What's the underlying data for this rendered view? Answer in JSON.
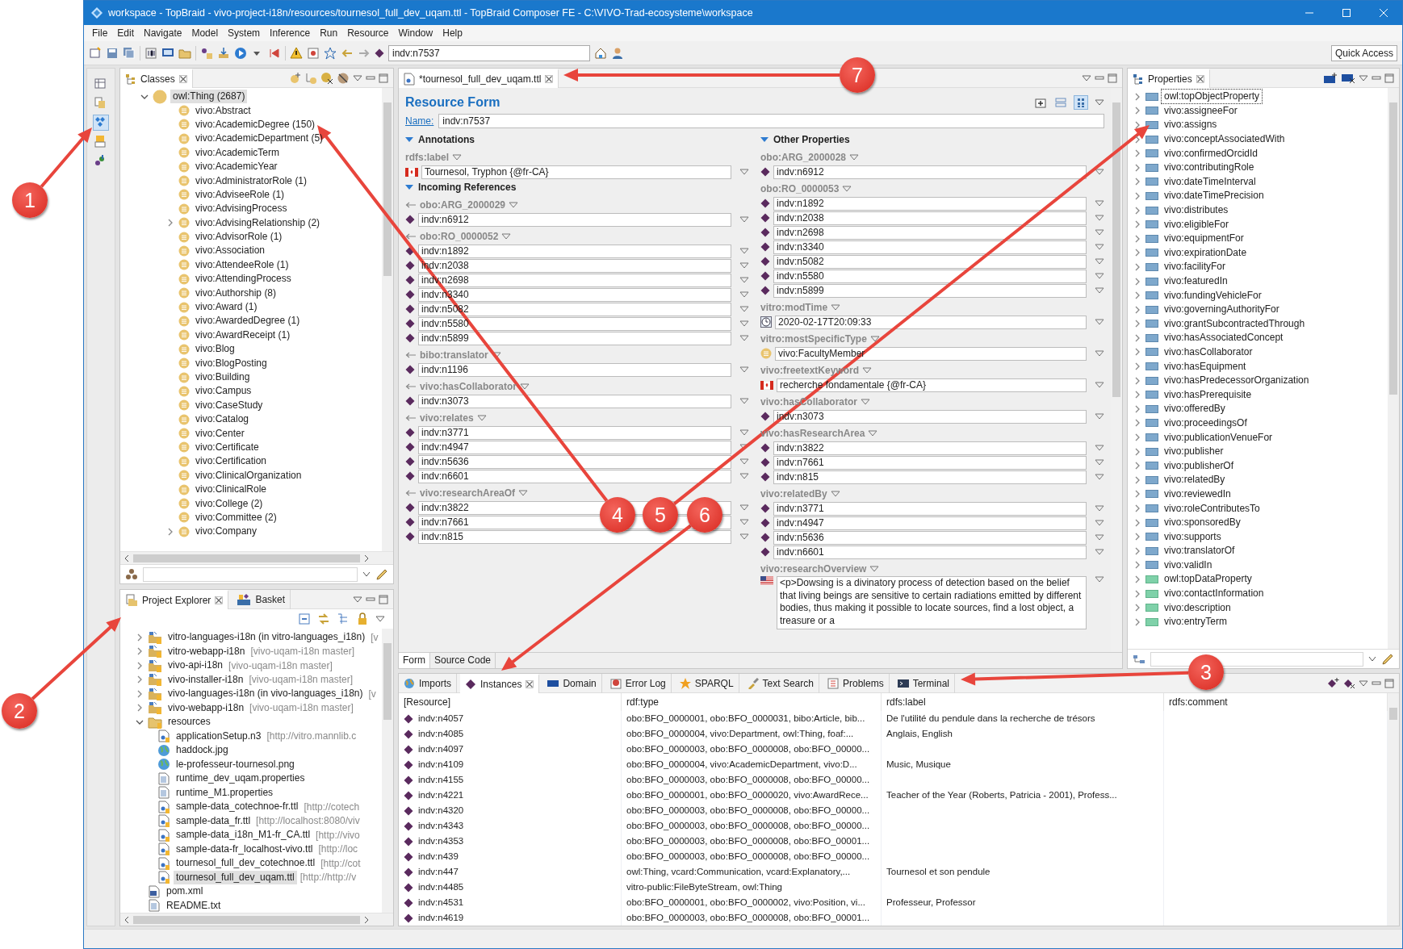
{
  "window": {
    "title": "workspace - TopBraid - vivo-project-i18n/resources/tournesol_full_dev_uqam.ttl - TopBraid Composer FE - C:\\VIVO-Trad-ecosysteme\\workspace"
  },
  "menu": [
    "File",
    "Edit",
    "Navigate",
    "Model",
    "System",
    "Inference",
    "Run",
    "Resource",
    "Window",
    "Help"
  ],
  "toolbar": {
    "resource_field": "indv:n7537",
    "quick_access": "Quick Access"
  },
  "classes_panel": {
    "tab": "Classes",
    "root": {
      "label": "owl:Thing  (2687)",
      "expanded": true,
      "selected": true,
      "children": [
        {
          "label": "vivo:Abstract",
          "expandable": false,
          "selected": false
        },
        {
          "label": "vivo:AcademicDegree  (150)",
          "expandable": false,
          "selected": false
        },
        {
          "label": "vivo:AcademicDepartment  (5)",
          "expandable": false,
          "selected": false
        },
        {
          "label": "vivo:AcademicTerm",
          "expandable": false,
          "selected": false
        },
        {
          "label": "vivo:AcademicYear",
          "expandable": false,
          "selected": false
        },
        {
          "label": "vivo:AdministratorRole  (1)",
          "expandable": false,
          "selected": false
        },
        {
          "label": "vivo:AdviseeRole  (1)",
          "expandable": false,
          "selected": false
        },
        {
          "label": "vivo:AdvisingProcess",
          "expandable": false,
          "selected": false
        },
        {
          "label": "vivo:AdvisingRelationship  (2)",
          "expandable": true,
          "selected": false
        },
        {
          "label": "vivo:AdvisorRole  (1)",
          "expandable": false,
          "selected": false
        },
        {
          "label": "vivo:Association",
          "expandable": false,
          "selected": false
        },
        {
          "label": "vivo:AttendeeRole  (1)",
          "expandable": false,
          "selected": false
        },
        {
          "label": "vivo:AttendingProcess",
          "expandable": false,
          "selected": false
        },
        {
          "label": "vivo:Authorship  (8)",
          "expandable": false,
          "selected": false
        },
        {
          "label": "vivo:Award  (1)",
          "expandable": false,
          "selected": false
        },
        {
          "label": "vivo:AwardedDegree  (1)",
          "expandable": false,
          "selected": false
        },
        {
          "label": "vivo:AwardReceipt  (1)",
          "expandable": false,
          "selected": false
        },
        {
          "label": "vivo:Blog",
          "expandable": false,
          "selected": false
        },
        {
          "label": "vivo:BlogPosting",
          "expandable": false,
          "selected": false
        },
        {
          "label": "vivo:Building",
          "expandable": false,
          "selected": false
        },
        {
          "label": "vivo:Campus",
          "expandable": false,
          "selected": false
        },
        {
          "label": "vivo:CaseStudy",
          "expandable": false,
          "selected": false
        },
        {
          "label": "vivo:Catalog",
          "expandable": false,
          "selected": false
        },
        {
          "label": "vivo:Center",
          "expandable": false,
          "selected": false
        },
        {
          "label": "vivo:Certificate",
          "expandable": false,
          "selected": false
        },
        {
          "label": "vivo:Certification",
          "expandable": false,
          "selected": false
        },
        {
          "label": "vivo:ClinicalOrganization",
          "expandable": false,
          "selected": false
        },
        {
          "label": "vivo:ClinicalRole",
          "expandable": false,
          "selected": false
        },
        {
          "label": "vivo:College  (2)",
          "expandable": false,
          "selected": false
        },
        {
          "label": "vivo:Committee  (2)",
          "expandable": false,
          "selected": false
        },
        {
          "label": "vivo:Company",
          "expandable": true,
          "selected": false
        }
      ]
    }
  },
  "project_panel": {
    "tabs": [
      {
        "label": "Project Explorer",
        "selected": true
      },
      {
        "label": "Basket",
        "selected": false
      }
    ],
    "items": [
      {
        "label": "vitro-languages-i18n (in vitro-languages_i18n)",
        "decoration": "[v",
        "kind": "project",
        "expanded": false,
        "selected": false
      },
      {
        "label": "vitro-webapp-i18n",
        "decoration": "[vivo-uqam-i18n master]",
        "kind": "project",
        "expanded": false,
        "selected": false
      },
      {
        "label": "vivo-api-i18n",
        "decoration": "[vivo-uqam-i18n master]",
        "kind": "project",
        "expanded": false,
        "selected": false
      },
      {
        "label": "vivo-installer-i18n",
        "decoration": "[vivo-uqam-i18n master]",
        "kind": "project",
        "expanded": false,
        "selected": false
      },
      {
        "label": "vivo-languages-i18n (in vivo-languages_i18n)",
        "decoration": "[v",
        "kind": "project",
        "expanded": false,
        "selected": false
      },
      {
        "label": "vivo-webapp-i18n",
        "decoration": "[vivo-uqam-i18n master]",
        "kind": "project",
        "expanded": false,
        "selected": false
      },
      {
        "label": "resources",
        "kind": "folder",
        "expanded": true,
        "selected": false,
        "children": [
          {
            "label": "applicationSetup.n3",
            "decoration": "[http://vitro.mannlib.c",
            "kind": "rdf",
            "selected": false
          },
          {
            "label": "haddock.jpg",
            "kind": "image",
            "selected": false
          },
          {
            "label": "le-professeur-tournesol.png",
            "kind": "image",
            "selected": false
          },
          {
            "label": "runtime_dev_uqam.properties",
            "kind": "text",
            "selected": false
          },
          {
            "label": "runtime_M1.properties",
            "kind": "text",
            "selected": false
          },
          {
            "label": "sample-data_cotechnoe-fr.ttl",
            "decoration": "[http://cotech",
            "kind": "rdf",
            "selected": false
          },
          {
            "label": "sample-data_fr.ttl",
            "decoration": "[http://localhost:8080/viv",
            "kind": "rdf",
            "selected": false
          },
          {
            "label": "sample-data_i18n_M1-fr_CA.ttl",
            "decoration": "[http://vivo",
            "kind": "rdf",
            "selected": false
          },
          {
            "label": "sample-data-fr_localhost-vivo.ttl",
            "decoration": "[http://loc",
            "kind": "rdf",
            "selected": false
          },
          {
            "label": "tournesol_full_dev_cotechnoe.ttl",
            "decoration": "[http://cot",
            "kind": "rdf",
            "selected": false
          },
          {
            "label": "tournesol_full_dev_uqam.ttl",
            "decoration": "[http://http://v",
            "kind": "rdf",
            "selected": true
          }
        ]
      },
      {
        "label": "pom.xml",
        "kind": "xml",
        "selected": false
      },
      {
        "label": "README.txt",
        "kind": "text",
        "selected": false
      }
    ]
  },
  "editor": {
    "tab": "*tournesol_full_dev_uqam.ttl",
    "title": "Resource Form",
    "name_label": "Name:",
    "name_value": "indv:n7537",
    "columns": [
      [
        {
          "title": "Annotations",
          "expanded": true,
          "properties": [
            {
              "label": "rdfs:label",
              "incoming": false,
              "values": [
                {
                  "kind": "literal",
                  "text": "Tournesol, Tryphon  {@fr-CA}"
                }
              ]
            }
          ]
        },
        {
          "title": "Incoming References",
          "expanded": true,
          "properties": [
            {
              "label": "obo:ARG_2000029",
              "incoming": true,
              "values": [
                {
                  "kind": "resource",
                  "text": "indv:n6912"
                }
              ]
            },
            {
              "label": "obo:RO_0000052",
              "incoming": true,
              "values": [
                {
                  "kind": "resource",
                  "text": "indv:n1892"
                },
                {
                  "kind": "resource",
                  "text": "indv:n2038"
                },
                {
                  "kind": "resource",
                  "text": "indv:n2698"
                },
                {
                  "kind": "resource",
                  "text": "indv:n3340"
                },
                {
                  "kind": "resource",
                  "text": "indv:n5082"
                },
                {
                  "kind": "resource",
                  "text": "indv:n5580"
                },
                {
                  "kind": "resource",
                  "text": "indv:n5899"
                }
              ]
            },
            {
              "label": "bibo:translator",
              "incoming": true,
              "values": [
                {
                  "kind": "resource",
                  "text": "indv:n1196"
                }
              ]
            },
            {
              "label": "vivo:hasCollaborator",
              "incoming": true,
              "values": [
                {
                  "kind": "resource",
                  "text": "indv:n3073"
                }
              ]
            },
            {
              "label": "vivo:relates",
              "incoming": true,
              "values": [
                {
                  "kind": "resource",
                  "text": "indv:n3771"
                },
                {
                  "kind": "resource",
                  "text": "indv:n4947"
                },
                {
                  "kind": "resource",
                  "text": "indv:n5636"
                },
                {
                  "kind": "resource",
                  "text": "indv:n6601"
                }
              ]
            },
            {
              "label": "vivo:researchAreaOf",
              "incoming": true,
              "values": [
                {
                  "kind": "resource",
                  "text": "indv:n3822"
                },
                {
                  "kind": "resource",
                  "text": "indv:n7661"
                },
                {
                  "kind": "resource",
                  "text": "indv:n815"
                }
              ]
            }
          ]
        }
      ],
      [
        {
          "title": "Other Properties",
          "expanded": true,
          "properties": [
            {
              "label": "obo:ARG_2000028",
              "incoming": false,
              "values": [
                {
                  "kind": "resource",
                  "text": "indv:n6912"
                }
              ]
            },
            {
              "label": "obo:RO_0000053",
              "incoming": false,
              "values": [
                {
                  "kind": "resource",
                  "text": "indv:n1892"
                },
                {
                  "kind": "resource",
                  "text": "indv:n2038"
                },
                {
                  "kind": "resource",
                  "text": "indv:n2698"
                },
                {
                  "kind": "resource",
                  "text": "indv:n3340"
                },
                {
                  "kind": "resource",
                  "text": "indv:n5082"
                },
                {
                  "kind": "resource",
                  "text": "indv:n5580"
                },
                {
                  "kind": "resource",
                  "text": "indv:n5899"
                }
              ]
            },
            {
              "label": "vitro:modTime",
              "incoming": false,
              "values": [
                {
                  "kind": "date",
                  "text": "2020-02-17T20:09:33"
                }
              ]
            },
            {
              "label": "vitro:mostSpecificType",
              "incoming": false,
              "values": [
                {
                  "kind": "class",
                  "text": "vivo:FacultyMember"
                }
              ]
            },
            {
              "label": "vivo:freetextKeyword",
              "incoming": false,
              "values": [
                {
                  "kind": "literal",
                  "text": "recherche fondamentale {@fr-CA}"
                }
              ]
            },
            {
              "label": "vivo:hasCollaborator",
              "incoming": false,
              "values": [
                {
                  "kind": "resource",
                  "text": "indv:n3073"
                }
              ]
            },
            {
              "label": "vivo:hasResearchArea",
              "incoming": false,
              "values": [
                {
                  "kind": "resource",
                  "text": "indv:n3822"
                },
                {
                  "kind": "resource",
                  "text": "indv:n7661"
                },
                {
                  "kind": "resource",
                  "text": "indv:n815"
                }
              ]
            },
            {
              "label": "vivo:relatedBy",
              "incoming": false,
              "values": [
                {
                  "kind": "resource",
                  "text": "indv:n3771"
                },
                {
                  "kind": "resource",
                  "text": "indv:n4947"
                },
                {
                  "kind": "resource",
                  "text": "indv:n5636"
                },
                {
                  "kind": "resource",
                  "text": "indv:n6601"
                }
              ]
            },
            {
              "label": "vivo:researchOverview",
              "incoming": false,
              "values": [
                {
                  "kind": "text",
                  "text": "<p>Dowsing is a divinatory process of detection based on the belief that living beings are sensitive to certain radiations emitted by different bodies, thus making it possible to locate sources, find a lost object, a treasure or a"
                }
              ]
            }
          ]
        }
      ]
    ],
    "bottom_tabs": [
      {
        "label": "Form",
        "selected": true
      },
      {
        "label": "Source Code",
        "selected": false
      }
    ]
  },
  "properties_panel": {
    "tab": "Properties",
    "items": [
      {
        "label": "owl:topObjectProperty",
        "kind": "object",
        "selected": true
      },
      {
        "label": "vivo:assigneeFor",
        "kind": "object",
        "selected": false
      },
      {
        "label": "vivo:assigns",
        "kind": "object",
        "selected": false
      },
      {
        "label": "vivo:conceptAssociatedWith",
        "kind": "object",
        "selected": false
      },
      {
        "label": "vivo:confirmedOrcidId",
        "kind": "object",
        "selected": false
      },
      {
        "label": "vivo:contributingRole",
        "kind": "object",
        "selected": false
      },
      {
        "label": "vivo:dateTimeInterval",
        "kind": "object",
        "selected": false
      },
      {
        "label": "vivo:dateTimePrecision",
        "kind": "object",
        "selected": false
      },
      {
        "label": "vivo:distributes",
        "kind": "object",
        "selected": false
      },
      {
        "label": "vivo:eligibleFor",
        "kind": "object",
        "selected": false
      },
      {
        "label": "vivo:equipmentFor",
        "kind": "object",
        "selected": false
      },
      {
        "label": "vivo:expirationDate",
        "kind": "object",
        "selected": false
      },
      {
        "label": "vivo:facilityFor",
        "kind": "object",
        "selected": false
      },
      {
        "label": "vivo:featuredIn",
        "kind": "object",
        "selected": false
      },
      {
        "label": "vivo:fundingVehicleFor",
        "kind": "object",
        "selected": false
      },
      {
        "label": "vivo:governingAuthorityFor",
        "kind": "object",
        "selected": false
      },
      {
        "label": "vivo:grantSubcontractedThrough",
        "kind": "object",
        "selected": false
      },
      {
        "label": "vivo:hasAssociatedConcept",
        "kind": "object",
        "selected": false
      },
      {
        "label": "vivo:hasCollaborator",
        "kind": "object",
        "selected": false
      },
      {
        "label": "vivo:hasEquipment",
        "kind": "object",
        "selected": false
      },
      {
        "label": "vivo:hasPredecessorOrganization",
        "kind": "object",
        "selected": false
      },
      {
        "label": "vivo:hasPrerequisite",
        "kind": "object",
        "selected": false
      },
      {
        "label": "vivo:offeredBy",
        "kind": "object",
        "selected": false
      },
      {
        "label": "vivo:proceedingsOf",
        "kind": "object",
        "selected": false
      },
      {
        "label": "vivo:publicationVenueFor",
        "kind": "object",
        "selected": false
      },
      {
        "label": "vivo:publisher",
        "kind": "object",
        "selected": false
      },
      {
        "label": "vivo:publisherOf",
        "kind": "object",
        "selected": false
      },
      {
        "label": "vivo:relatedBy",
        "kind": "object",
        "selected": false
      },
      {
        "label": "vivo:reviewedIn",
        "kind": "object",
        "selected": false
      },
      {
        "label": "vivo:roleContributesTo",
        "kind": "object",
        "selected": false
      },
      {
        "label": "vivo:sponsoredBy",
        "kind": "object",
        "selected": false
      },
      {
        "label": "vivo:supports",
        "kind": "object",
        "selected": false
      },
      {
        "label": "vivo:translatorOf",
        "kind": "object",
        "selected": false
      },
      {
        "label": "vivo:validIn",
        "kind": "object",
        "selected": false
      },
      {
        "label": "owl:topDataProperty",
        "kind": "data",
        "selected": false
      },
      {
        "label": "vivo:contactInformation",
        "kind": "data",
        "selected": false
      },
      {
        "label": "vivo:description",
        "kind": "data",
        "selected": false
      },
      {
        "label": "vivo:entryTerm",
        "kind": "data",
        "selected": false
      }
    ]
  },
  "bottom_panel": {
    "tabs": [
      {
        "label": "Imports",
        "selected": false
      },
      {
        "label": "Instances",
        "selected": true
      },
      {
        "label": "Domain",
        "selected": false
      },
      {
        "label": "Error Log",
        "selected": false
      },
      {
        "label": "SPARQL",
        "selected": false
      },
      {
        "label": "Text Search",
        "selected": false
      },
      {
        "label": "Problems",
        "selected": false
      },
      {
        "label": "Terminal",
        "selected": false
      }
    ],
    "table": {
      "columns": [
        "[Resource]",
        "rdf:type",
        "rdfs:label",
        "rdfs:comment"
      ],
      "rows": [
        {
          "resource": "indv:n4057",
          "type": "obo:BFO_0000001, obo:BFO_0000031, bibo:Article, bib...",
          "label": "De l'utilité du pendule dans la recherche de trésors"
        },
        {
          "resource": "indv:n4085",
          "type": "obo:BFO_0000004, vivo:Department, owl:Thing, foaf:...",
          "label": "Anglais, English"
        },
        {
          "resource": "indv:n4097",
          "type": "obo:BFO_0000003, obo:BFO_0000008, obo:BFO_00000..."
        },
        {
          "resource": "indv:n4109",
          "type": "obo:BFO_0000004, vivo:AcademicDepartment, vivo:D...",
          "label": "Music, Musique"
        },
        {
          "resource": "indv:n4155",
          "type": "obo:BFO_0000003, obo:BFO_0000008, obo:BFO_00000..."
        },
        {
          "resource": "indv:n4221",
          "type": "obo:BFO_0000001, obo:BFO_0000020, vivo:AwardRece...",
          "label": "Teacher of the Year (Roberts, Patricia  - 2001), Profess..."
        },
        {
          "resource": "indv:n4320",
          "type": "obo:BFO_0000003, obo:BFO_0000008, obo:BFO_00000..."
        },
        {
          "resource": "indv:n4343",
          "type": "obo:BFO_0000003, obo:BFO_0000008, obo:BFO_00000..."
        },
        {
          "resource": "indv:n4353",
          "type": "obo:BFO_0000003, obo:BFO_0000008, obo:BFO_00001..."
        },
        {
          "resource": "indv:n439",
          "type": "obo:BFO_0000003, obo:BFO_0000008, obo:BFO_00000..."
        },
        {
          "resource": "indv:n447",
          "type": "owl:Thing, vcard:Communication, vcard:Explanatory,...",
          "label": "Tournesol et son pendule"
        },
        {
          "resource": "indv:n4485",
          "type": "vitro-public:FileByteStream, owl:Thing"
        },
        {
          "resource": "indv:n4531",
          "type": "obo:BFO_0000001, obo:BFO_0000002, vivo:Position, vi...",
          "label": "Professeur, Professor"
        },
        {
          "resource": "indv:n4619",
          "type": "obo:BFO_0000003, obo:BFO_0000008, obo:BFO_00001..."
        }
      ]
    }
  },
  "callouts": [
    {
      "label": "1"
    },
    {
      "label": "2"
    },
    {
      "label": "3"
    },
    {
      "label": "4"
    },
    {
      "label": "5"
    },
    {
      "label": "6"
    },
    {
      "label": "7"
    }
  ]
}
